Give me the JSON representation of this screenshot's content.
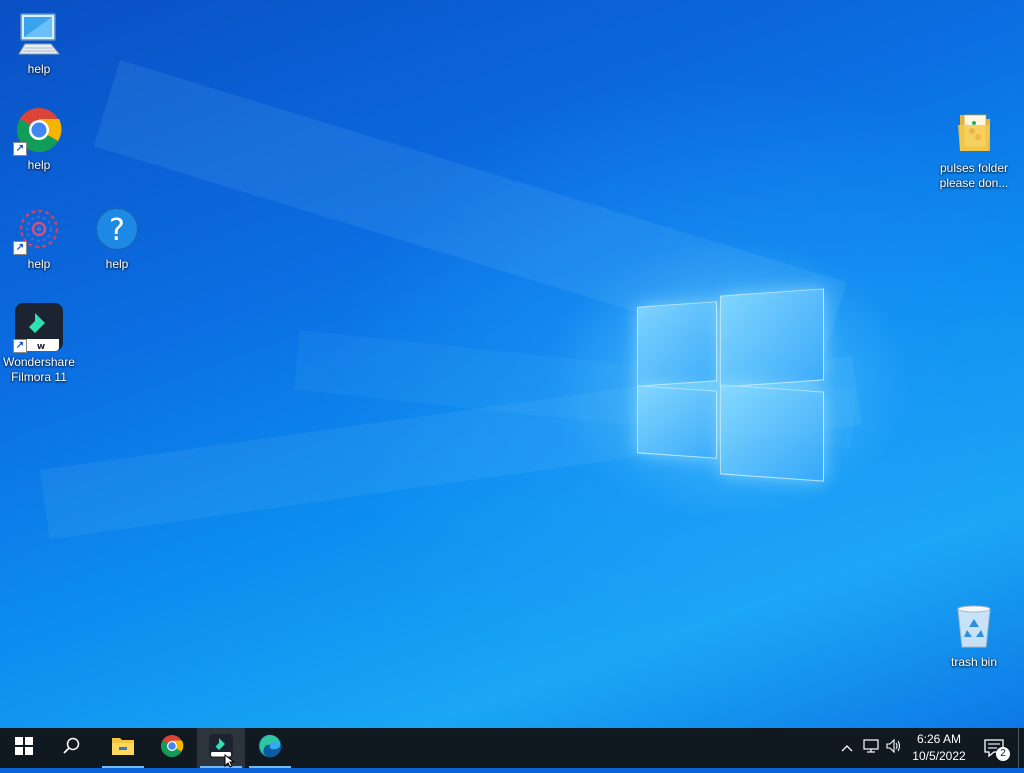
{
  "desktop": {
    "icons": [
      {
        "label": "help",
        "icon": "computer-icon"
      },
      {
        "label": "help",
        "icon": "chrome-icon"
      },
      {
        "label": "help",
        "icon": "flower-icon"
      },
      {
        "label": "help",
        "icon": "help-icon"
      },
      {
        "label": "Wondershare Filmora 11",
        "icon": "filmora-icon"
      },
      {
        "label": "pulses folder please don...",
        "icon": "folder-icon"
      },
      {
        "label": "trash bin",
        "icon": "recycle-bin-icon"
      }
    ]
  },
  "taskbar": {
    "start": "start-icon",
    "search": "search-icon",
    "pinned": [
      "file-explorer-icon",
      "chrome-icon",
      "filmora-icon",
      "edge-icon"
    ],
    "tray": {
      "time": "6:26 AM",
      "date": "10/5/2022",
      "notification_count": "2"
    }
  },
  "colors": {
    "taskbar": "#101820",
    "accent": "#76b9ed",
    "wallpaper": "#0b6ee2"
  }
}
